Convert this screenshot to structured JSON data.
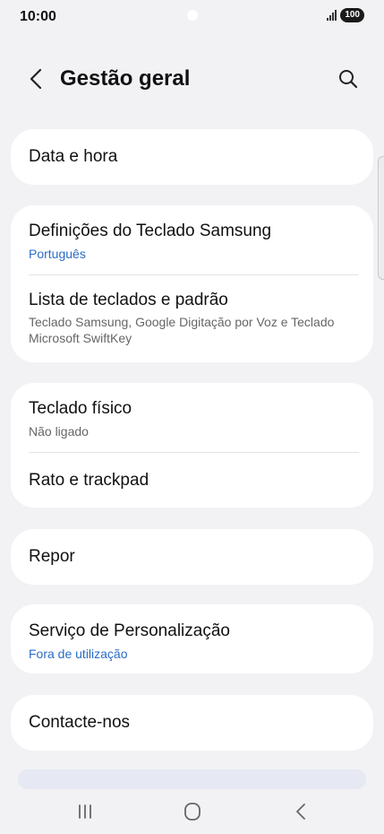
{
  "status_bar": {
    "time": "10:00",
    "battery": "100"
  },
  "header": {
    "title": "Gestão geral"
  },
  "cards": {
    "date_time": {
      "title": "Data e hora"
    },
    "samsung_keyboard": {
      "title": "Definições do Teclado Samsung",
      "subtitle": "Português"
    },
    "keyboard_list": {
      "title": "Lista de teclados e padrão",
      "subtitle": "Teclado Samsung, Google Digitação por Voz e Teclado Microsoft SwiftKey"
    },
    "physical_keyboard": {
      "title": "Teclado físico",
      "subtitle": "Não ligado"
    },
    "mouse_trackpad": {
      "title": "Rato e trackpad"
    },
    "reset": {
      "title": "Repor"
    },
    "personalization": {
      "title": "Serviço de Personalização",
      "subtitle": "Fora de utilização"
    },
    "contact": {
      "title": "Contacte-nos"
    }
  },
  "icons": [
    "back-icon",
    "search-icon",
    "recents-icon",
    "home-icon",
    "nav-back-icon",
    "signal-icon",
    "battery-icon"
  ],
  "colors": {
    "background": "#f2f2f5",
    "card": "#ffffff",
    "accent_subtitle": "#2b6cc7",
    "gray_subtitle": "#666666"
  }
}
